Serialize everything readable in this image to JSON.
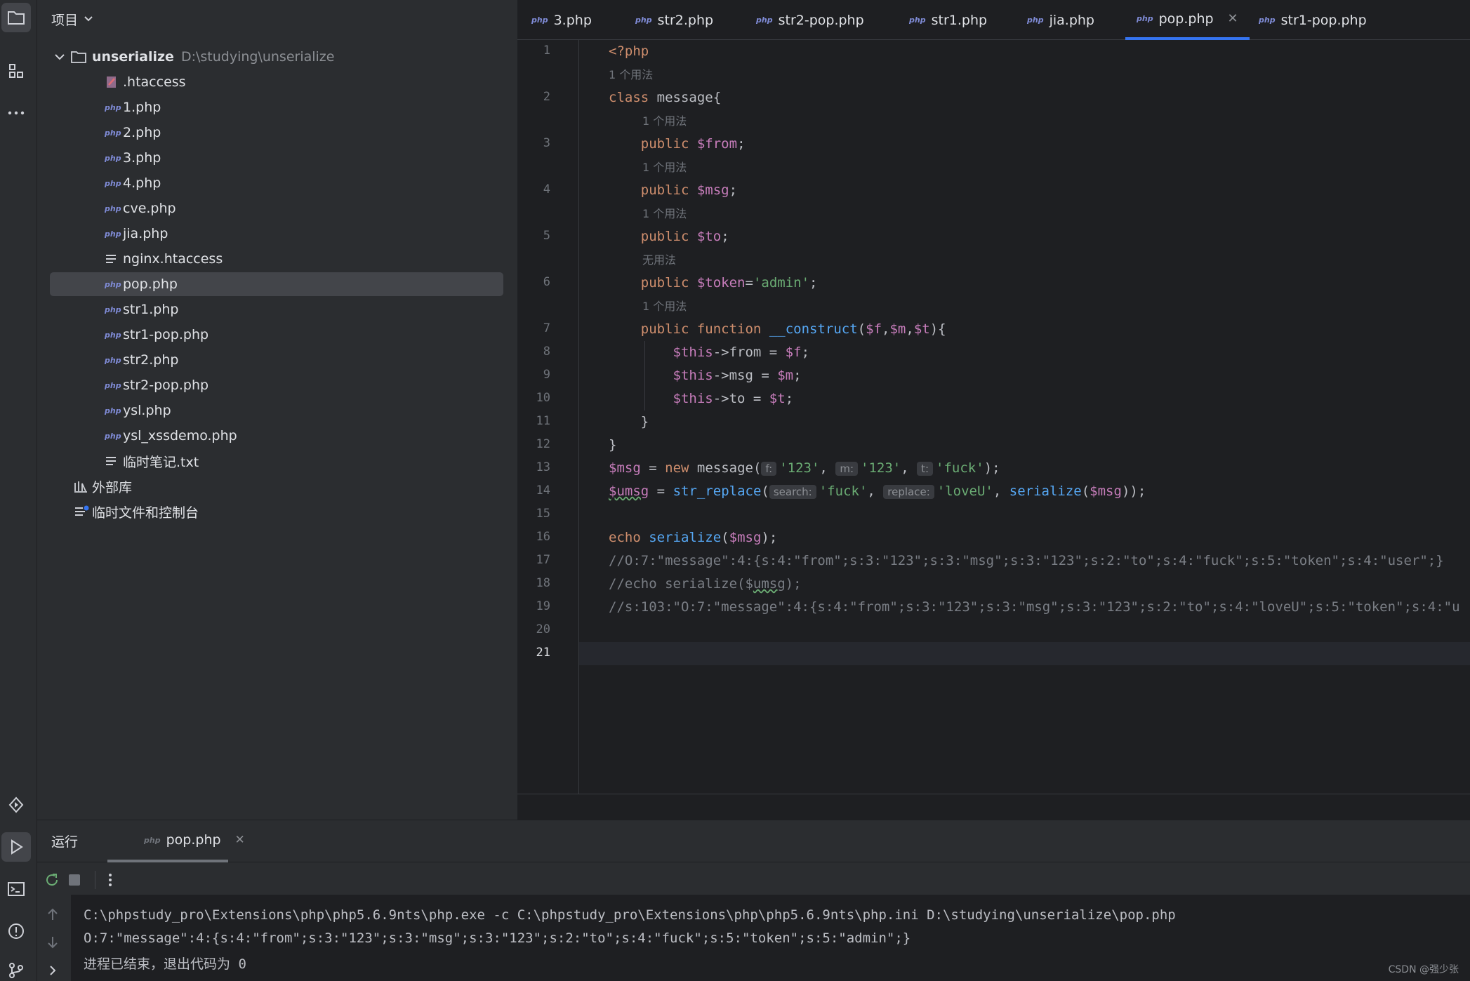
{
  "project_panel": {
    "title": "项目",
    "root": {
      "name": "unserialize",
      "path": "D:\\studying\\unserialize"
    },
    "files": [
      {
        "name": ".htaccess",
        "icon": "htaccess-icon"
      },
      {
        "name": "1.php",
        "icon": "php"
      },
      {
        "name": "2.php",
        "icon": "php"
      },
      {
        "name": "3.php",
        "icon": "php"
      },
      {
        "name": "4.php",
        "icon": "php"
      },
      {
        "name": "cve.php",
        "icon": "php"
      },
      {
        "name": "jia.php",
        "icon": "php"
      },
      {
        "name": "nginx.htaccess",
        "icon": "text"
      },
      {
        "name": "pop.php",
        "icon": "php",
        "selected": true
      },
      {
        "name": "str1.php",
        "icon": "php"
      },
      {
        "name": "str1-pop.php",
        "icon": "php"
      },
      {
        "name": "str2.php",
        "icon": "php"
      },
      {
        "name": "str2-pop.php",
        "icon": "php"
      },
      {
        "name": "ysl.php",
        "icon": "php"
      },
      {
        "name": "ysl_xssdemo.php",
        "icon": "php"
      },
      {
        "name": "临时笔记.txt",
        "icon": "text"
      }
    ],
    "external_libraries": "外部库",
    "scratches": "临时文件和控制台"
  },
  "php_badge": "php",
  "tabs": [
    {
      "label": "3.php"
    },
    {
      "label": "str2.php"
    },
    {
      "label": "str2-pop.php"
    },
    {
      "label": "str1.php"
    },
    {
      "label": "jia.php"
    },
    {
      "label": "pop.php",
      "active": true
    },
    {
      "label": "str1-pop.php"
    }
  ],
  "code": {
    "line_numbers": [
      "1",
      "2",
      "3",
      "4",
      "5",
      "6",
      "7",
      "8",
      "9",
      "10",
      "11",
      "12",
      "13",
      "14",
      "15",
      "16",
      "17",
      "18",
      "19",
      "20",
      "21"
    ],
    "current_line": "21",
    "usage_hints": {
      "one_usage": "1 个用法",
      "no_usage": "无用法"
    },
    "l1": "<?php",
    "l2_kw": "class",
    "l2_rest": " message{",
    "public": "public",
    "l3_var": "$from",
    "l4_var": "$msg",
    "l5_var": "$to",
    "l6_var": "$token",
    "l6_str": "'admin'",
    "semi": ";",
    "eq": "=",
    "l7_kw": "function",
    "l7_fn": "__construct",
    "l7_open": "(",
    "l7_f": "$f",
    "l7_m": "$m",
    "l7_t": "$t",
    "l7_close": "){",
    "comma": ",",
    "this": "$this",
    "l8_prop": "->from = ",
    "l9_prop": "->msg = ",
    "l10_prop": "->to = ",
    "close_brace": "}",
    "l13_var": "$msg",
    "l13_new": "new",
    "l13_cls": " message(",
    "l13_inlay_f": "f:",
    "l13_inlay_m": "m:",
    "l13_inlay_t": "t:",
    "l13_s1": "'123'",
    "l13_s2": "'123'",
    "l13_s3": "'fuck'",
    "l13_end": ");",
    "l14_var": "$umsg",
    "l14_fn": "str_replace",
    "l14_inlay_search": "search:",
    "l14_inlay_replace": "replace:",
    "l14_s1": "'fuck'",
    "l14_s2": "'loveU'",
    "l14_fn2": "serialize",
    "l14_arg": "$msg",
    "l14_end": "));",
    "l16_kw": "echo",
    "l16_fn": "serialize",
    "l16_arg": "$msg",
    "l16_end": ");",
    "l17": "//O:7:\"message\":4:{s:4:\"from\";s:3:\"123\";s:3:\"msg\";s:3:\"123\";s:2:\"to\";s:4:\"fuck\";s:5:\"token\";s:4:\"user\";}",
    "l18_a": "//echo serialize($",
    "l18_b": "umsg",
    "l18_c": ");",
    "l19": "//s:103:\"O:7:\"message\":4:{s:4:\"from\";s:3:\"123\";s:3:\"msg\";s:3:\"123\";s:2:\"to\";s:4:\"loveU\";s:5:\"token\";s:4:\"u"
  },
  "run_panel": {
    "title": "运行",
    "tab_label": "pop.php",
    "console": [
      "C:\\phpstudy_pro\\Extensions\\php\\php5.6.9nts\\php.exe -c C:\\phpstudy_pro\\Extensions\\php\\php5.6.9nts\\php.ini D:\\studying\\unserialize\\pop.php",
      "O:7:\"message\":4:{s:4:\"from\";s:3:\"123\";s:3:\"msg\";s:3:\"123\";s:2:\"to\";s:4:\"fuck\";s:5:\"token\";s:5:\"admin\";}",
      "进程已结束，退出代码为 0"
    ]
  },
  "watermark": "CSDN @强少张",
  "colors": {
    "keyword": "#cf8e6d",
    "variable": "#c77dbb",
    "string": "#6aab73",
    "function": "#56a8f5",
    "comment": "#7a7e85",
    "accent": "#3574f0"
  }
}
